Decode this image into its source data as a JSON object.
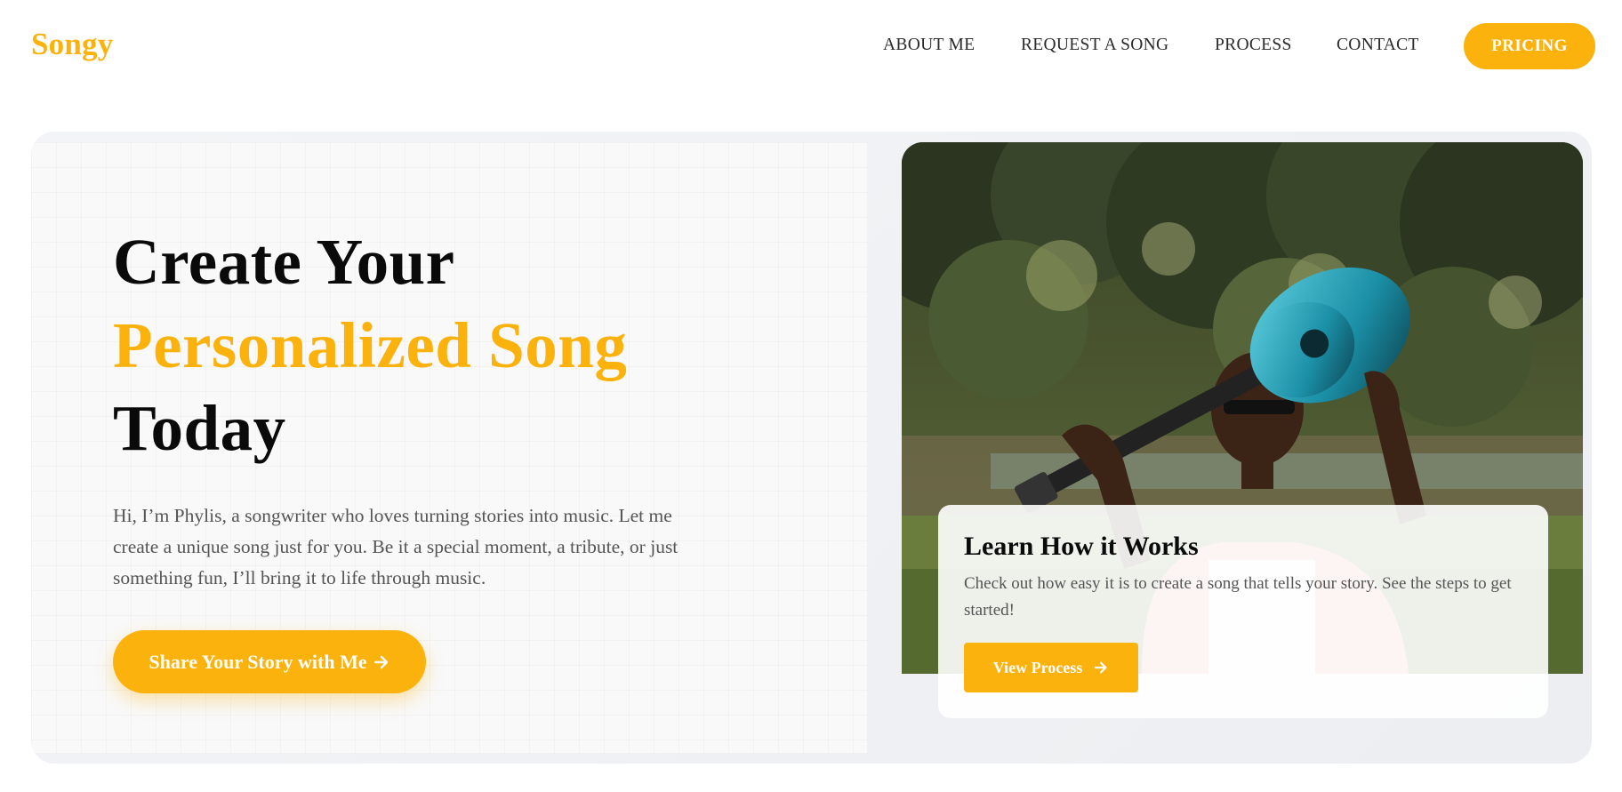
{
  "brand": {
    "logo": "Songy",
    "accent_color": "#FBB20D"
  },
  "nav": {
    "items": [
      {
        "label": "ABOUT ME"
      },
      {
        "label": "REQUEST A SONG"
      },
      {
        "label": "PROCESS"
      },
      {
        "label": "CONTACT"
      }
    ],
    "pricing_label": "PRICING"
  },
  "hero": {
    "title_line1": "Create Your",
    "title_line2": "Personalized Song",
    "title_line3": "Today",
    "intro": "Hi, I’m Phylis, a songwriter who loves turning stories into music. Let me create a unique song just for you. Be it a special moment, a tribute, or just something fun, I’ll bring it to life through music.",
    "cta_label": "Share Your Story with Me",
    "cta_icon": "arrow-right-icon"
  },
  "photo": {
    "subject": "woman with blue acoustic guitar over shoulder in a garden"
  },
  "info_card": {
    "title": "Learn How it Works",
    "text": "Check out how easy it is to create a song that tells your story. See the steps to get started!",
    "button_label": "View Process",
    "button_icon": "arrow-right-icon"
  }
}
